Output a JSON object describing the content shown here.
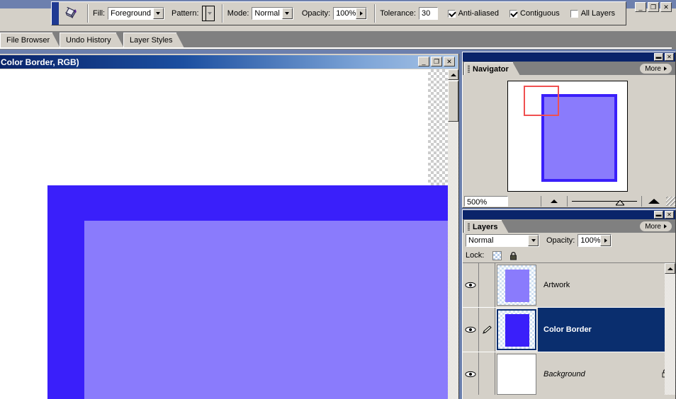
{
  "app": {
    "window_controls": {
      "minimize": "_",
      "restore": "❐",
      "close": "✕"
    }
  },
  "options_bar": {
    "tool_icon": "paint-bucket-icon",
    "fill_label": "Fill:",
    "fill_value": "Foreground",
    "pattern_label": "Pattern:",
    "pattern_value": "",
    "mode_label": "Mode:",
    "mode_value": "Normal",
    "opacity_label": "Opacity:",
    "opacity_value": "100%",
    "tolerance_label": "Tolerance:",
    "tolerance_value": "30",
    "checkboxes": [
      {
        "label": "Anti-aliased",
        "checked": true
      },
      {
        "label": "Contiguous",
        "checked": true
      },
      {
        "label": "All Layers",
        "checked": false
      }
    ]
  },
  "palette_tabs": [
    {
      "label": "File Browser"
    },
    {
      "label": "Undo History"
    },
    {
      "label": "Layer Styles"
    }
  ],
  "document": {
    "title": "Color Border, RGB)",
    "window_controls": {
      "minimize": "_",
      "maximize": "❐",
      "close": "✕"
    }
  },
  "navigator": {
    "tab_label": "Navigator",
    "more_label": "More",
    "zoom_value": "500%",
    "zoom_out_icon": "small-mountain-icon",
    "zoom_in_icon": "large-mountain-icon",
    "view_rect_color": "#f05050",
    "panel_close": "✕",
    "panel_minimize": "▬"
  },
  "layers": {
    "tab_label": "Layers",
    "more_label": "More",
    "blend_mode": "Normal",
    "opacity_label": "Opacity:",
    "opacity_value": "100%",
    "lock_label": "Lock:",
    "lock_items": [
      "transparency-checker-icon",
      "lock-all-icon"
    ],
    "panel_close": "✕",
    "panel_minimize": "▬",
    "rows": [
      {
        "name": "Artwork",
        "visible": true,
        "selected": false,
        "has_brush": false,
        "locked": false,
        "italic": false,
        "thumb_border": "",
        "thumb_fill": "#8a7bfc"
      },
      {
        "name": "Color Border",
        "visible": true,
        "selected": true,
        "has_brush": true,
        "locked": false,
        "italic": false,
        "thumb_border": "",
        "thumb_fill": "#3a1ffa"
      },
      {
        "name": "Background",
        "visible": true,
        "selected": false,
        "has_brush": false,
        "locked": true,
        "italic": true,
        "thumb_border": "",
        "thumb_fill": "#ffffff"
      }
    ]
  },
  "canvas": {
    "border_color": "#3a1ffa",
    "fill_color": "#8a7bfc",
    "background_color": "#ffffff"
  }
}
